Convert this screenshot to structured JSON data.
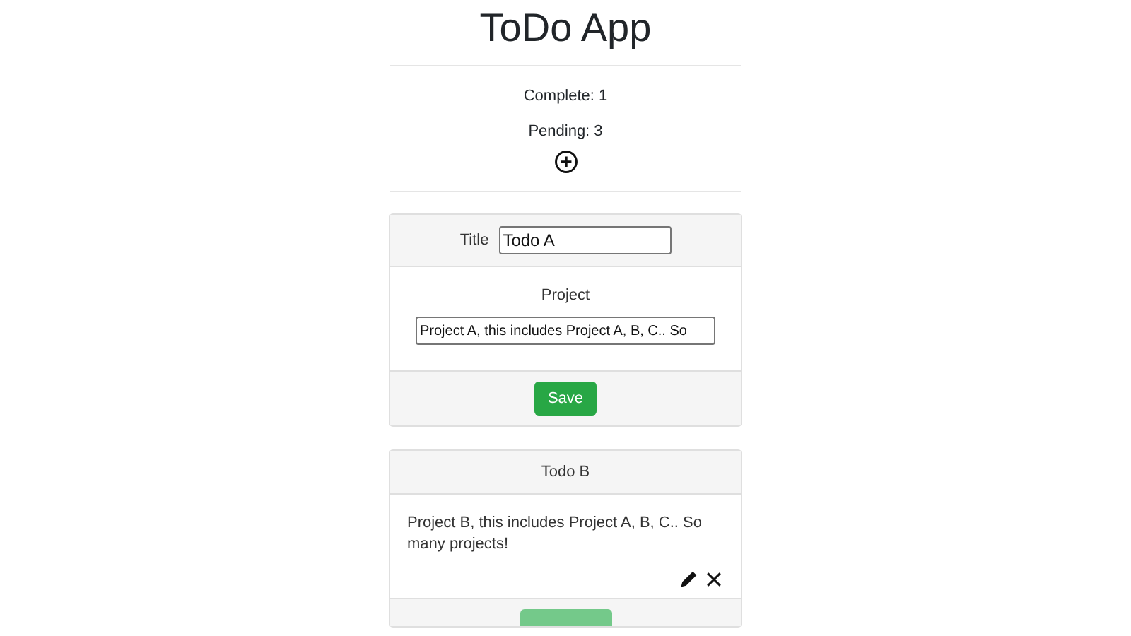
{
  "title": "ToDo App",
  "stats": [
    {
      "text": "Complete: 1"
    },
    {
      "text": "Pending: 3"
    }
  ],
  "editor": {
    "title_label": "Title",
    "title_value": "Todo A",
    "project_label": "Project",
    "project_value": "Project A, this includes Project A, B, C.. So",
    "save_label": "Save"
  },
  "todos": [
    {
      "title": "Todo B",
      "project": "Project B, this includes Project A, B, C.. So many projects!",
      "footer_button": {
        "disabled": true
      }
    }
  ]
}
